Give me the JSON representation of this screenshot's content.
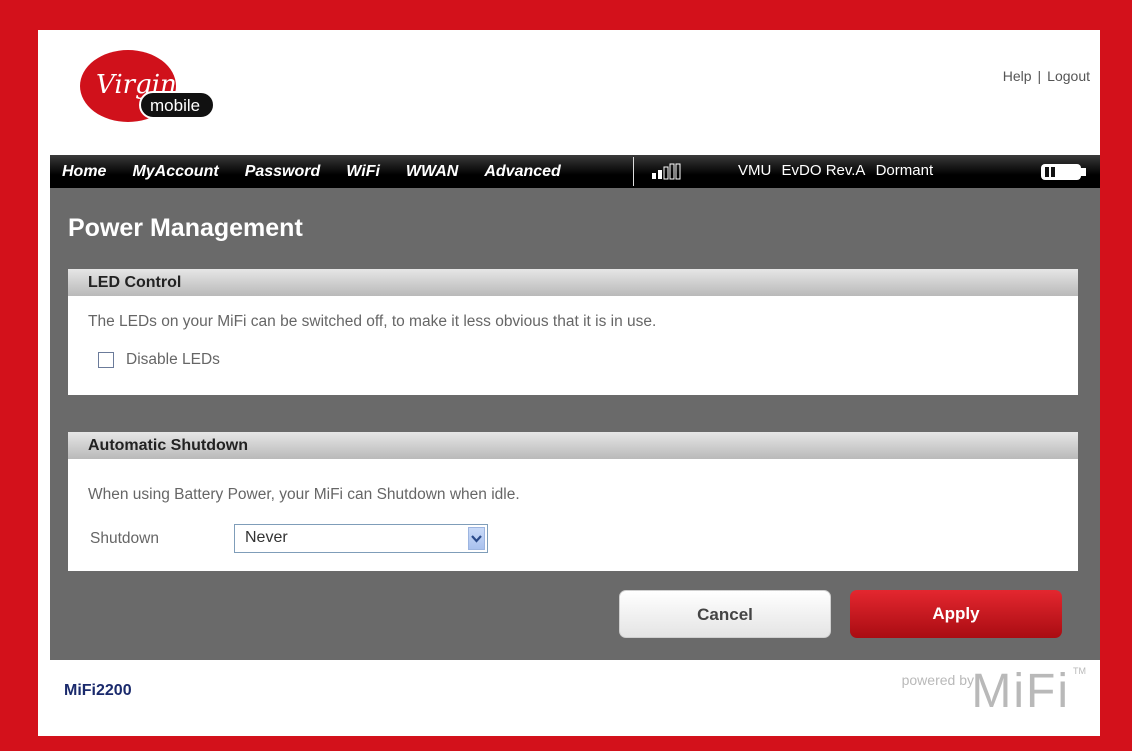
{
  "header": {
    "logo": {
      "brand_script": "Virgin",
      "brand_word": "mobile"
    },
    "help_label": "Help",
    "separator": "|",
    "logout_label": "Logout"
  },
  "nav": {
    "items": [
      "Home",
      "MyAccount",
      "Password",
      "WiFi",
      "WWAN",
      "Advanced"
    ],
    "signal_icon": "signal-strength-icon",
    "status": {
      "carrier": "VMU",
      "network": "EvDO Rev.A",
      "state": "Dormant"
    },
    "battery_icon": "battery-icon"
  },
  "page": {
    "title": "Power Management"
  },
  "led_panel": {
    "title": "LED Control",
    "description": "The LEDs on your MiFi can be switched off, to make it less obvious that it is in use.",
    "checkbox_label": "Disable LEDs",
    "checked": false
  },
  "shutdown_panel": {
    "title": "Automatic Shutdown",
    "description": "When using Battery Power, your MiFi can Shutdown when idle.",
    "select_label": "Shutdown",
    "select_value": "Never"
  },
  "buttons": {
    "cancel": "Cancel",
    "apply": "Apply"
  },
  "footer": {
    "model": "MiFi2200",
    "powered_by": "powered by",
    "powered_logo": "MiFi",
    "trademark": "TM"
  },
  "colors": {
    "brand_red": "#d3111b",
    "content_bg": "#6a6a6a",
    "apply_red": "#c8161e"
  }
}
